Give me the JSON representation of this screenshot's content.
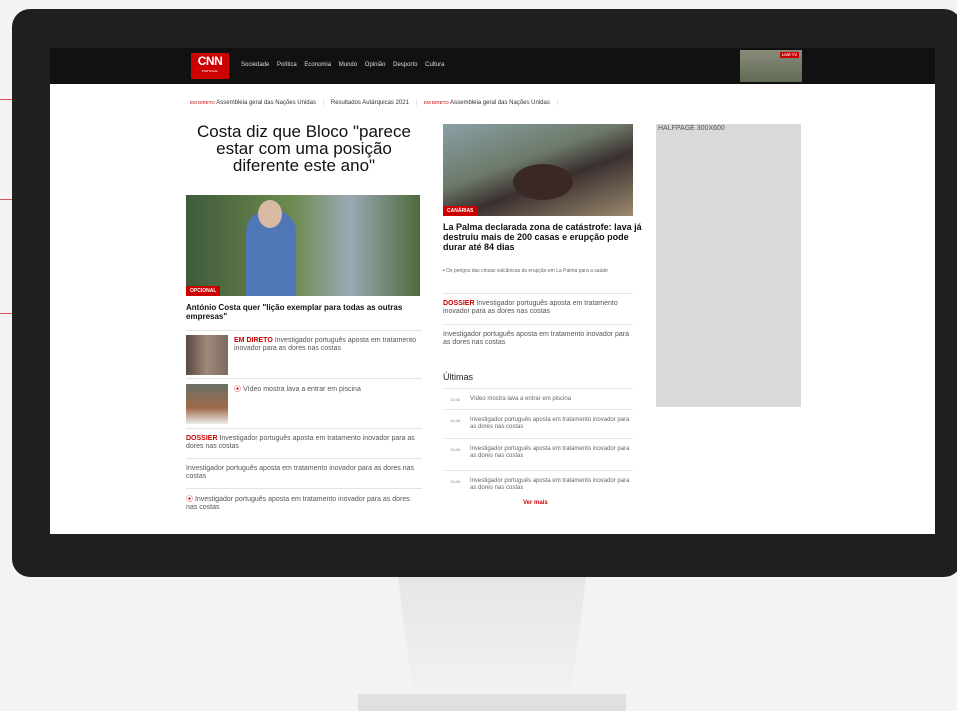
{
  "nav": {
    "logo_main": "CNN",
    "logo_sub": "PORTUGAL",
    "items": [
      "Sociedade",
      "Política",
      "Economia",
      "Mundo",
      "Opinião",
      "Desporto",
      "Cultura"
    ],
    "live_tv": "LIVE TV"
  },
  "ticker": [
    {
      "tag": "EM DIRETO",
      "text": "Assembleia geral das Nações Unidas"
    },
    {
      "tag": "",
      "text": "Resultados Autárquicas 2021"
    },
    {
      "tag": "EM DIRETO",
      "text": "Assembleia geral das Nações Unidas"
    }
  ],
  "col1": {
    "headline": "Costa diz que Bloco \"parece estar com uma posição diferente este ano\"",
    "photo_label": "OPCIONAL",
    "subheadline": "António Costa quer \"lição exemplar para todas as outras empresas\"",
    "item1_tag": "EM DIRETO",
    "item1_text": "Investigador português aposta em tratamento inovador para as dores nas costas",
    "item2_text": "Vídeo mostra lava a entrar em piscina",
    "item3_tag": "DOSSIER",
    "item3_text": "Investigador português aposta em tratamento inovador para as dores nas costas",
    "item4_text": "Investigador português aposta em tratamento inovador para as dores nas costas",
    "item5_text": "Investigador português aposta em tratamento inovador para as dores nas costas"
  },
  "col2": {
    "photo_label": "CANÁRIAS",
    "headline": "La Palma declarada zona de catástrofe: lava já destruiu mais de 200 casas e erupção pode durar até 84 dias",
    "bullet": "Os perigos das cinzas vulcânicas da erupção em La Palma para a saúde",
    "item1_tag": "DOSSIER",
    "item1_text": "Investigador português aposta em tratamento inovador para as dores nas costas",
    "item2_text": "Investigador português aposta em tratamento inovador para as dores nas costas",
    "latest_title": "Últimas",
    "latest": [
      {
        "time": "10:48",
        "text": "Vídeo mostra lava a entrar em piscina"
      },
      {
        "time": "10:48",
        "text": "Investigador português aposta em tratamento inovador para as dores nas costas"
      },
      {
        "time": "10:48",
        "text": "Investigador português aposta em tratamento inovador para as dores nas costas"
      },
      {
        "time": "10:48",
        "text": "Investigador português aposta em tratamento inovador para as dores nas costas"
      }
    ],
    "see_more": "Ver mais"
  },
  "ad": {
    "text": "HALFPAGE 300X600"
  },
  "colors": {
    "brand": "#cc0000",
    "monitor": "#1f1f1f"
  }
}
